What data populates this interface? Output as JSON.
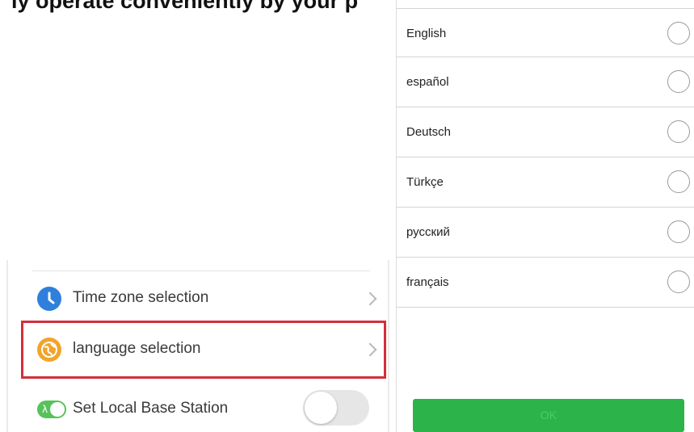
{
  "header": {
    "cut_text": "ly operate conveniently by your p"
  },
  "settings": {
    "items": [
      {
        "label": "Time zone selection",
        "icon": "clock-icon",
        "icon_color": "#2f7fdc"
      },
      {
        "label": "language selection",
        "icon": "globe-icon",
        "icon_color": "#f2a42a",
        "highlighted": true,
        "highlight_color": "#d32f3a"
      },
      {
        "label": "Set Local Base Station",
        "icon": "toggle-icon",
        "icon_color": "#58c25a",
        "toggle_on": false
      }
    ]
  },
  "language_dialog": {
    "options": [
      {
        "label": "English",
        "selected": false
      },
      {
        "label": "español",
        "selected": false
      },
      {
        "label": "Deutsch",
        "selected": false
      },
      {
        "label": "Türkçe",
        "selected": false
      },
      {
        "label": "русский",
        "selected": false
      },
      {
        "label": "français",
        "selected": false
      }
    ],
    "ok_label": "OK",
    "ok_color": "#2cb34a"
  }
}
